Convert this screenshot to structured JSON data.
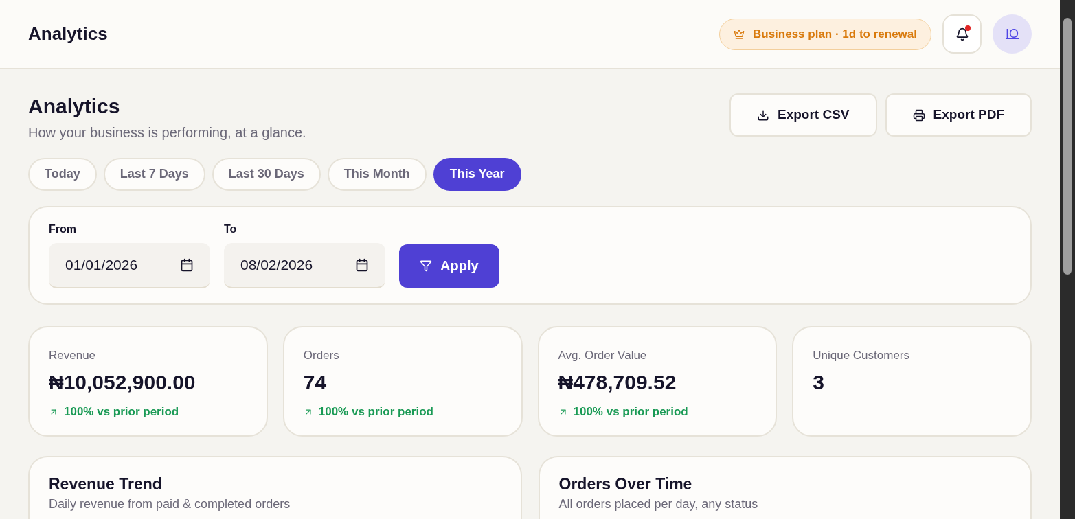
{
  "header": {
    "title": "Analytics",
    "plan_badge": "Business plan · 1d to renewal",
    "notifications": {
      "unread": true
    },
    "avatar": "IO"
  },
  "page": {
    "title": "Analytics",
    "subtitle": "How your business is performing, at a glance.",
    "actions": [
      {
        "label": "Export CSV",
        "kind": "download"
      },
      {
        "label": "Export PDF",
        "kind": "print"
      }
    ]
  },
  "ranges": [
    {
      "label": "Today",
      "selected": false
    },
    {
      "label": "Last 7 Days",
      "selected": false
    },
    {
      "label": "Last 30 Days",
      "selected": false
    },
    {
      "label": "This Month",
      "selected": false
    },
    {
      "label": "This Year",
      "selected": true
    }
  ],
  "filter": {
    "from_label": "From",
    "from_value": "01/01/2026",
    "to_label": "To",
    "to_value": "08/02/2026",
    "apply": "Apply"
  },
  "metrics": [
    {
      "label": "Revenue",
      "value": "₦10,052,900.00",
      "delta": "100% vs prior period"
    },
    {
      "label": "Orders",
      "value": "74",
      "delta": "100% vs prior period"
    },
    {
      "label": "Avg. Order Value",
      "value": "₦478,709.52",
      "delta": "100% vs prior period"
    },
    {
      "label": "Unique Customers",
      "value": "3"
    }
  ],
  "charts": [
    {
      "title": "Revenue Trend",
      "subtitle": "Daily revenue from paid & completed orders"
    },
    {
      "title": "Orders Over Time",
      "subtitle": "All orders placed per day, any status"
    }
  ]
}
